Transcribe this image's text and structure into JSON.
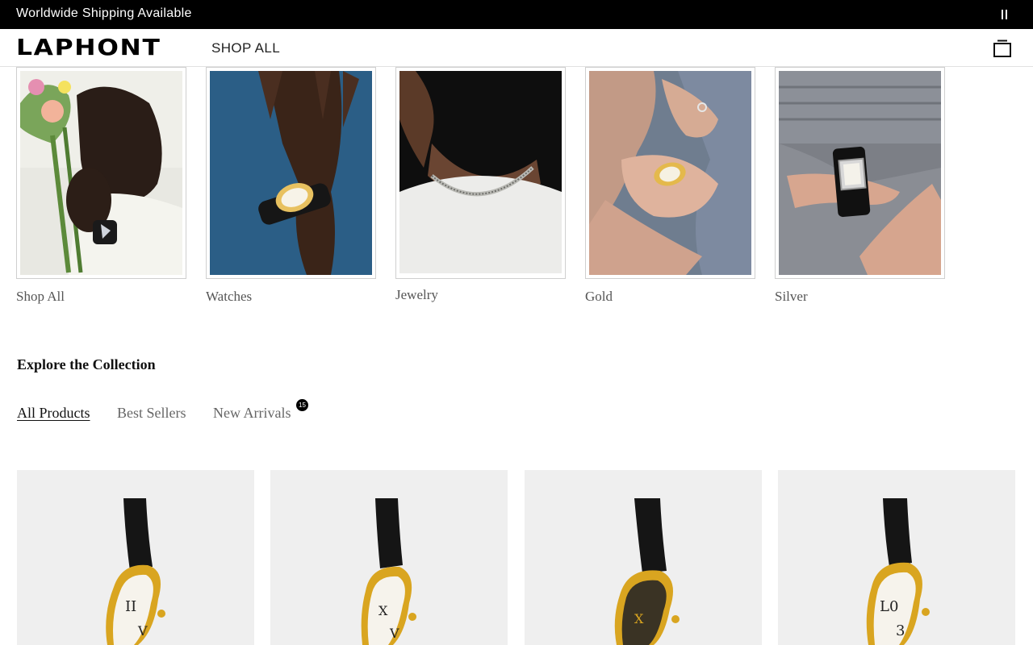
{
  "announcement": {
    "text": "Worldwide Shipping Available",
    "pause_icon": "pause-icon"
  },
  "header": {
    "logo": "LAPHONT",
    "nav_shop_all": "SHOP ALL",
    "cart_icon": "bag-icon"
  },
  "categories": [
    {
      "label": "Shop All"
    },
    {
      "label": "Watches"
    },
    {
      "label": "Jewelry"
    },
    {
      "label": "Gold"
    },
    {
      "label": "Silver"
    }
  ],
  "collection": {
    "heading": "Explore the Collection",
    "tabs": [
      {
        "label": "All Products",
        "active": true
      },
      {
        "label": "Best Sellers",
        "active": false
      },
      {
        "label": "New Arrivals",
        "active": false,
        "badge": "15"
      }
    ]
  },
  "products": [
    {
      "dial": "white"
    },
    {
      "dial": "white"
    },
    {
      "dial": "black"
    },
    {
      "dial": "white-numerals"
    }
  ],
  "colors": {
    "accent": "#000000",
    "gold": "#d9a520",
    "card_bg": "#efefef"
  }
}
